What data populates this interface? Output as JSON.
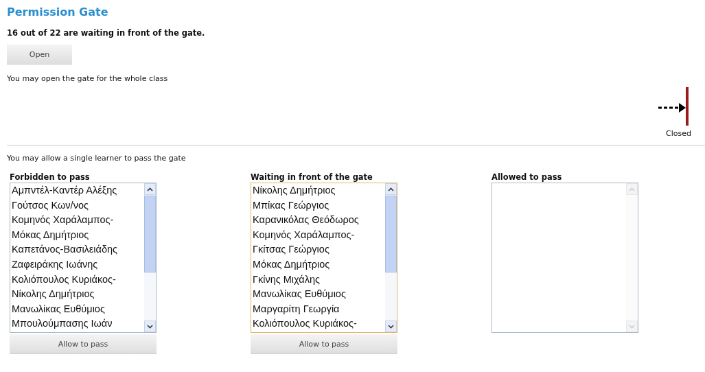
{
  "title": "Permission Gate",
  "summary": "16 out of 22 are waiting in front of the gate.",
  "open_button": "Open",
  "class_hint": "You may open the gate for the whole class",
  "gate_status": "Closed",
  "single_hint": "You may allow a single learner to pass the gate",
  "lists": [
    {
      "heading": "Forbidden to pass",
      "focused": false,
      "button": "Allow to pass",
      "items": [
        "Αμπντέλ-Καντέρ Αλέξης",
        "Γούτσος Κων/νος",
        "Κομηνός Χαράλαμπος-",
        "Μόκας Δημήτριος",
        "Καπετάνος-Βασιλειάδης",
        "Ζαφειράκης Ιωάνης",
        "Κολιόπουλος Κυριάκος-",
        "Νίκολης Δημήτριος",
        "Μανωλίκας Ευθύμιος",
        "Μπουλούμπασης Ιωάν"
      ]
    },
    {
      "heading": "Waiting in front of the gate",
      "focused": true,
      "button": "Allow to pass",
      "items": [
        "Νίκολης Δημήτριος",
        "Μπίκας Γεώργιος",
        "Καρανικόλας Θεόδωρος",
        "Κομηνός Χαράλαμπος-",
        "Γκίτσας Γεώργιος",
        "Μόκας Δημήτριος",
        "Γκίνης Μιχάλης",
        "Μανωλίκας Ευθύμιος",
        "Μαργαρίτη Γεωργία",
        "Κολιόπουλος Κυριάκος-"
      ]
    },
    {
      "heading": "Allowed to pass",
      "focused": false
    }
  ]
}
